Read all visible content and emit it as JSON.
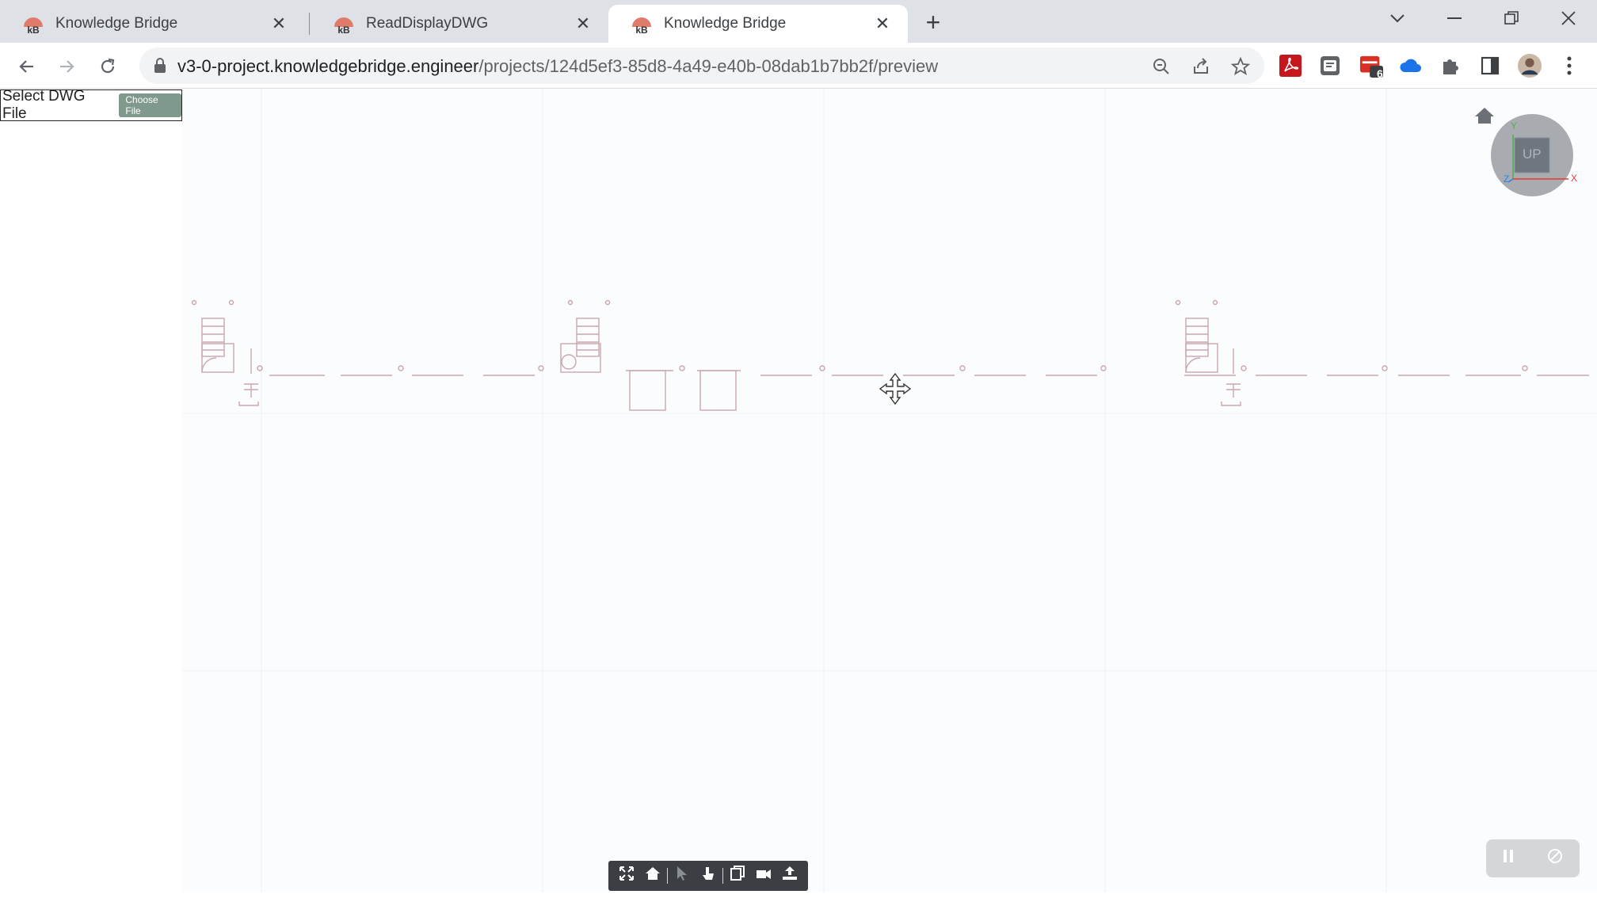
{
  "browser": {
    "tabs": [
      {
        "title": "Knowledge Bridge",
        "active": false
      },
      {
        "title": "ReadDisplayDWG",
        "active": false
      },
      {
        "title": "Knowledge Bridge",
        "active": true
      }
    ],
    "new_tab_symbol": "+",
    "url_host": "v3-0-project.knowledgebridge.engineer",
    "url_path": "/projects/124d5ef3-85d8-4a49-e40b-08dab1b7bb2f/preview",
    "extension_badge": "6",
    "icons": {
      "back": "arrow-left-icon",
      "forward": "arrow-right-icon",
      "reload": "reload-icon",
      "zoom": "zoom-icon",
      "share": "share-icon",
      "bookmark": "star-icon",
      "extensions": "puzzle-icon",
      "side_panel": "side-panel-icon",
      "menu": "kebab-menu-icon"
    },
    "colors": {
      "tabstrip": "#dee1e6",
      "favicon": "#e07a6a",
      "drawing_line": "#b47a84"
    }
  },
  "page": {
    "file_input": {
      "label": "Select DWG File",
      "button": "Choose File"
    },
    "viewcube": {
      "face": "UP",
      "axis_x": "X",
      "axis_y": "Y",
      "axis_z": "Z"
    },
    "toolbar_icons": [
      "fit-to-view-icon",
      "home-icon",
      "select-icon",
      "pan-icon",
      "section-icon",
      "camera-icon",
      "explode-icon"
    ],
    "corner_icons": [
      "pause-icon",
      "settings-icon"
    ]
  }
}
